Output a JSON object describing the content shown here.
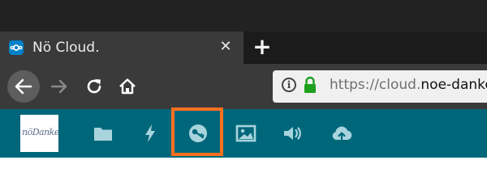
{
  "browser": {
    "tab": {
      "title": "Nö Cloud.",
      "favicon": "nextcloud-icon",
      "close_label": "✕"
    },
    "new_tab_label": "+",
    "nav": {
      "back_icon": "arrow-left-icon",
      "forward_icon": "arrow-right-icon",
      "reload_icon": "reload-icon",
      "home_icon": "home-icon"
    },
    "urlbar": {
      "info_label": "i",
      "lock_icon": "lock-icon",
      "scheme": "https://cloud.",
      "host": "noe-danke"
    }
  },
  "app": {
    "logo_text": "nöDanke",
    "nav_icons": [
      "folder-icon",
      "lightning-icon",
      "passwords-key-icon",
      "image-icon",
      "speaker-icon",
      "cloud-upload-icon"
    ],
    "active_item": "passwords-key-icon"
  },
  "colors": {
    "app_header": "#00677b",
    "highlight": "#ff7020",
    "lock_green": "#1fa01f"
  }
}
